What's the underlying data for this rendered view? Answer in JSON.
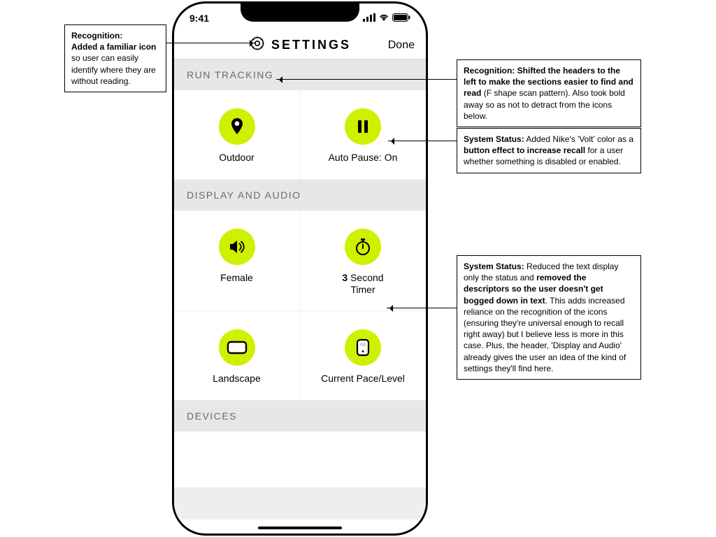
{
  "status_bar": {
    "time": "9:41"
  },
  "nav": {
    "title": "SETTINGS",
    "done": "Done"
  },
  "colors": {
    "volt": "#cff000"
  },
  "sections": {
    "run_tracking": {
      "header": "RUN TRACKING",
      "tiles": {
        "outdoor": {
          "label": "Outdoor",
          "icon": "location-pin"
        },
        "auto_pause": {
          "label": "Auto Pause: On",
          "icon": "pause"
        }
      }
    },
    "display_audio": {
      "header": "DISPLAY AND AUDIO",
      "tiles": {
        "voice": {
          "label": "Female",
          "icon": "volume"
        },
        "timer": {
          "value": "3",
          "label_rest": " Second\nTimer",
          "icon": "stopwatch"
        },
        "orientation": {
          "label": "Landscape",
          "icon": "landscape-rect"
        },
        "metric": {
          "label": "Current Pace/Level",
          "icon": "device"
        }
      }
    },
    "devices": {
      "header": "DEVICES"
    }
  },
  "annotations": {
    "a1": "Recognition:\nAdded a familiar icon so user can easily identify where they are without reading.",
    "a1_bold": "Recognition: Added a familiar icon",
    "a2_line1": "Recognition: Shifted the headers to the left to make the sections easier to find and read",
    "a2_line2": " (F shape scan pattern). Also took bold away so as not to detract from the icons below.",
    "a3_line1": "System Status:",
    "a3_line2": " Added Nike's 'Volt' color as a ",
    "a3_line3": "button effect to increase recall",
    "a3_line4": " for a user whether something is disabled or enabled.",
    "a4_l1": "System Status:",
    "a4_l2": " Reduced the text display only the status and ",
    "a4_l3": "removed the descriptors so the user doesn't get bogged down in text",
    "a4_l4": ". This adds increased reliance on the recognition of the icons (ensuring they're universal enough to recall right away) but I believe less is more in this case. Plus, the header, 'Display and Audio' already gives the user an idea of the kind of settings they'll find here."
  }
}
